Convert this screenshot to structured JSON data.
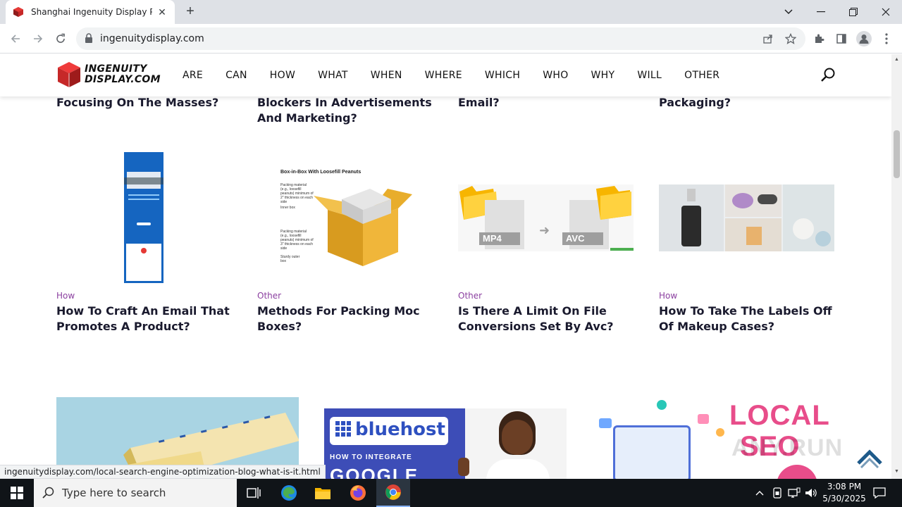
{
  "browser": {
    "tab_title": "Shanghai Ingenuity Display Prod",
    "new_tab": "+",
    "url": "ingenuitydisplay.com",
    "status_url": "ingenuitydisplay.com/local-search-engine-optimization-blog-what-is-it.html"
  },
  "site": {
    "logo_line1": "INGENUITY",
    "logo_line2": "DISPLAY.COM",
    "nav": [
      "ARE",
      "CAN",
      "HOW",
      "WHAT",
      "WHEN",
      "WHERE",
      "WHICH",
      "WHO",
      "WHY",
      "WILL",
      "OTHER"
    ]
  },
  "top_row": [
    {
      "title": "Focusing On The Masses?"
    },
    {
      "title": "Blockers In Advertisements And Marketing?"
    },
    {
      "title": "Email?"
    },
    {
      "title": "Packaging?"
    }
  ],
  "posts": [
    {
      "category": "How",
      "title": "How To Craft An Email That Promotes A Product?"
    },
    {
      "category": "Other",
      "title": "Methods For Packing Moc Boxes?"
    },
    {
      "category": "Other",
      "title": "Is There A Limit On File Conversions Set By Avc?"
    },
    {
      "category": "How",
      "title": "How To Take The Labels Off Of Makeup Cases?"
    }
  ],
  "thumb_text": {
    "box_title": "Box-in-Box With Loosefill Peanuts",
    "box_lbl1": "Packing material (e.g., loosefill peanuts) minimum of 2\" thickness on each side",
    "box_lbl2": "Inner box",
    "box_lbl3": "Packing material (e.g., loosefill peanuts) minimum of 3\" thickness on each side",
    "box_lbl4": "Sturdy outer box",
    "mp4": "MP4",
    "avc": "AVC",
    "bluehost": "bluehost",
    "integrate": "HOW TO INTEGRATE",
    "google": "GOOGLE",
    "local": "LOCAL",
    "seo": "SEO"
  },
  "watermark": "ANY.RUN",
  "taskbar": {
    "search_placeholder": "Type here to search",
    "time": "3:08 PM",
    "date": "5/30/2025"
  }
}
